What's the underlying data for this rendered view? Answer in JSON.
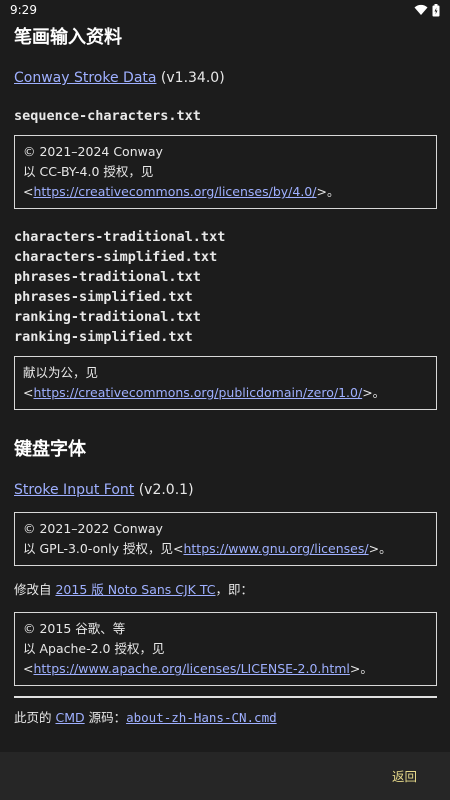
{
  "status": {
    "time": "9:29"
  },
  "section1": {
    "title": "笔画输入资料",
    "data_link": "Conway Stroke Data",
    "data_version": " (v1.34.0)",
    "file": "sequence-characters.txt",
    "license1": {
      "line1": "© 2021–2024 Conway",
      "line2": "以 CC-BY-4.0 授权，见",
      "pre": "<",
      "url": "https://creativecommons.org/licenses/by/4.0/",
      "post": ">。"
    },
    "files": [
      "characters-traditional.txt",
      "characters-simplified.txt",
      "phrases-traditional.txt",
      "phrases-simplified.txt",
      "ranking-traditional.txt",
      "ranking-simplified.txt"
    ],
    "license2": {
      "line1": "献以为公，见",
      "pre": "<",
      "url": "https://creativecommons.org/publicdomain/zero/1.0/",
      "post": ">。"
    }
  },
  "section2": {
    "title": "键盘字体",
    "font_link": "Stroke Input Font",
    "font_version": " (v2.0.1)",
    "license1": {
      "line1": "© 2021–2022 Conway",
      "line2_pre": "以 GPL-3.0-only 授权，见<",
      "url": "https://www.gnu.org/licenses/",
      "post": ">。"
    },
    "modified_pre": "修改自 ",
    "modified_link": "2015 版 Noto Sans CJK TC",
    "modified_post": "，即：",
    "license2": {
      "line1": "© 2015 谷歌、等",
      "line2": "以 Apache-2.0 授权，见",
      "pre": "<",
      "url": "https://www.apache.org/licenses/LICENSE-2.0.html",
      "post": ">。"
    }
  },
  "footer": {
    "pre": "此页的 ",
    "cmd_link": "CMD",
    "mid": " 源码：",
    "source_link": "about-zh-Hans-CN.cmd"
  },
  "bottombar": {
    "back_label": "返回"
  },
  "colors": {
    "background": "#1c1c1c",
    "link": "#9fb0ff",
    "back": "#e6d98a"
  },
  "icons": [
    "wifi-icon",
    "battery-icon"
  ]
}
